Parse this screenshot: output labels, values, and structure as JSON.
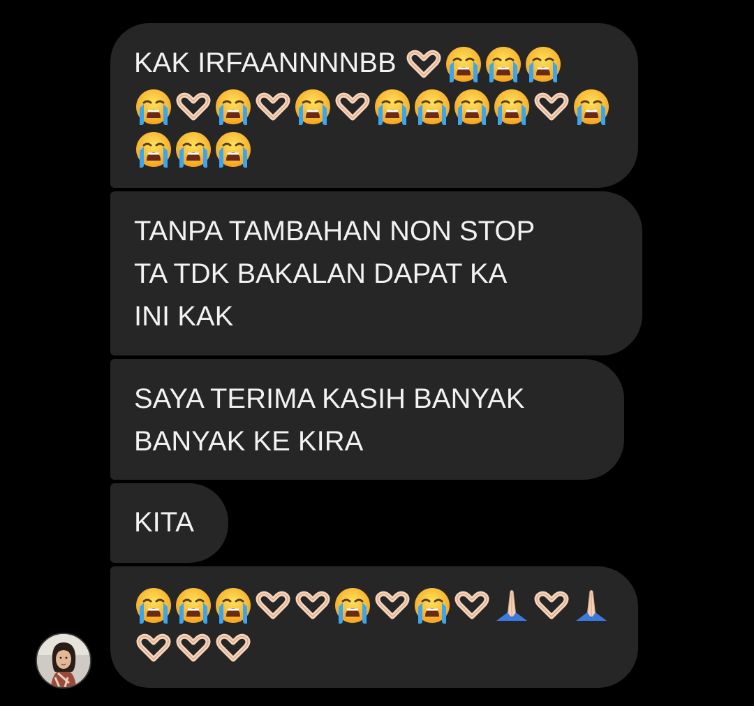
{
  "messages": [
    {
      "lines": [
        {
          "text": "KAK IRFAANNNNBB ",
          "emoji": [
            "hand-heart",
            "crying",
            "crying",
            "crying"
          ]
        },
        {
          "text": "",
          "emoji": [
            "crying",
            "hand-heart",
            "crying",
            "hand-heart",
            "crying",
            "hand-heart",
            "crying",
            "crying",
            "crying",
            "crying",
            "hand-heart",
            "crying"
          ]
        },
        {
          "text": "",
          "emoji": [
            "crying",
            "crying",
            "crying"
          ]
        }
      ]
    },
    {
      "lines": [
        {
          "text": "TANPA TAMBAHAN NON STOP"
        },
        {
          "text": "TA TDK BAKALAN DAPAT KA"
        },
        {
          "text": "INI KAK"
        }
      ]
    },
    {
      "lines": [
        {
          "text": "SAYA TERIMA KASIH BANYAK"
        },
        {
          "text": "BANYAK KE KIRA"
        }
      ]
    },
    {
      "lines": [
        {
          "text": "KITA"
        }
      ]
    },
    {
      "lines": [
        {
          "text": "",
          "emoji": [
            "crying",
            "crying",
            "crying",
            "hand-heart",
            "hand-heart",
            "crying",
            "hand-heart",
            "crying",
            "hand-heart",
            "folded-hands",
            "hand-heart",
            "folded-hands"
          ]
        },
        {
          "text": "",
          "emoji": [
            "hand-heart",
            "hand-heart",
            "hand-heart"
          ]
        }
      ]
    }
  ],
  "colors": {
    "background": "#000000",
    "bubble": "#262626",
    "text": "#f2f2f2"
  },
  "avatar": {
    "icon": "avatar-photo"
  }
}
